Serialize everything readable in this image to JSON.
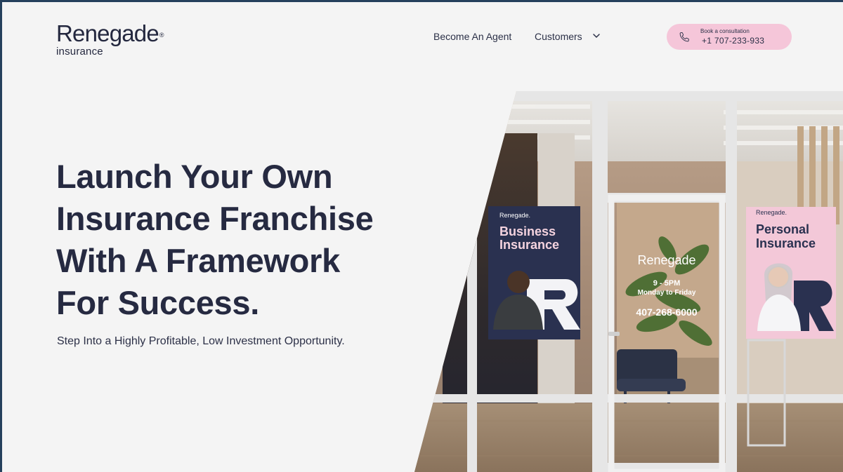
{
  "header": {
    "logo_name": "Renegade",
    "logo_reg": "®",
    "logo_sub": "insurance",
    "nav": {
      "become_agent": "Become An Agent",
      "customers": "Customers"
    },
    "cta": {
      "label": "Book a consultation",
      "phone": "+1 707-233-933"
    }
  },
  "hero": {
    "title_lines": [
      "Launch Your Own",
      "Insurance Franchise",
      "With A Framework",
      "For Success."
    ],
    "subtitle": "Step Into a Highly Profitable, Low Investment Opportunity."
  },
  "storefront": {
    "left_sign": {
      "brand": "Renegade.",
      "title_line1": "Business",
      "title_line2": "Insurance"
    },
    "door": {
      "brand": "Renegade",
      "hours": "9 - 5PM",
      "days": "Monday to Friday",
      "phone": "407-268-6000"
    },
    "right_sign": {
      "brand": "Renegade.",
      "title_line1": "Personal",
      "title_line2": "Insurance"
    }
  },
  "colors": {
    "page_bg": "#f4f4f4",
    "navy": "#262a41",
    "cta_pink": "#f5c6d9",
    "sign_navy": "#2a3150",
    "sign_pink": "#f3c8d8"
  },
  "icons": {
    "cta": "phone-icon",
    "nav": "chevron-down-icon"
  }
}
